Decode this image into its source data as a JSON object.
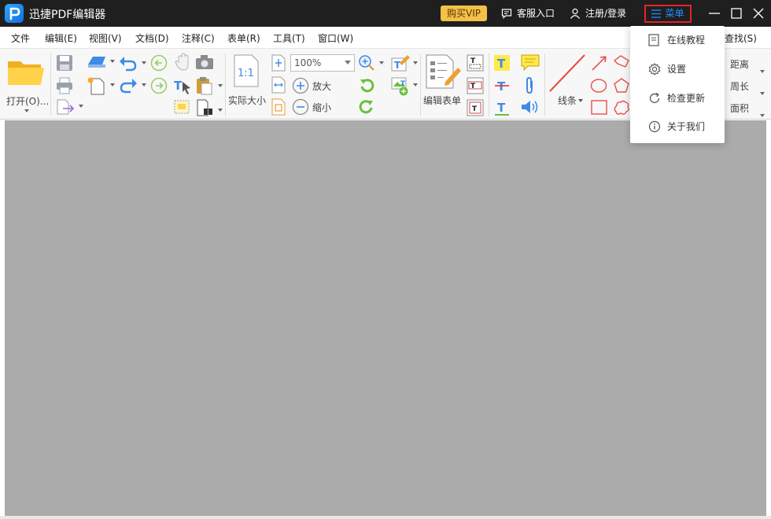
{
  "app": {
    "title": "迅捷PDF编辑器",
    "vip_label": "购买VIP",
    "service_label": "客服入口",
    "login_label": "注册/登录",
    "menu_label": "菜单",
    "accent_color": "#1e90ff",
    "vip_color": "#f3c148",
    "highlight_color": "#e5232a"
  },
  "menubar": {
    "items": [
      "文件",
      "编辑(E)",
      "视图(V)",
      "文档(D)",
      "注释(C)",
      "表单(R)",
      "工具(T)",
      "窗口(W)"
    ],
    "find_label": "查找(S)"
  },
  "toolbar": {
    "open_label": "打开(O)...",
    "actual_size_label": "实际大小",
    "zoom_value": "100%",
    "zoom_in_label": "放大",
    "zoom_out_label": "缩小",
    "edit_form_label": "编辑表单",
    "line_label": "线条",
    "distance_label": "距离",
    "perimeter_label": "周长",
    "area_label": "面积"
  },
  "dropdown": {
    "items": [
      {
        "label": "在线教程",
        "icon": "document-icon"
      },
      {
        "label": "设置",
        "icon": "gear-icon"
      },
      {
        "label": "检查更新",
        "icon": "refresh-icon"
      },
      {
        "label": "关于我们",
        "icon": "info-icon"
      }
    ]
  }
}
